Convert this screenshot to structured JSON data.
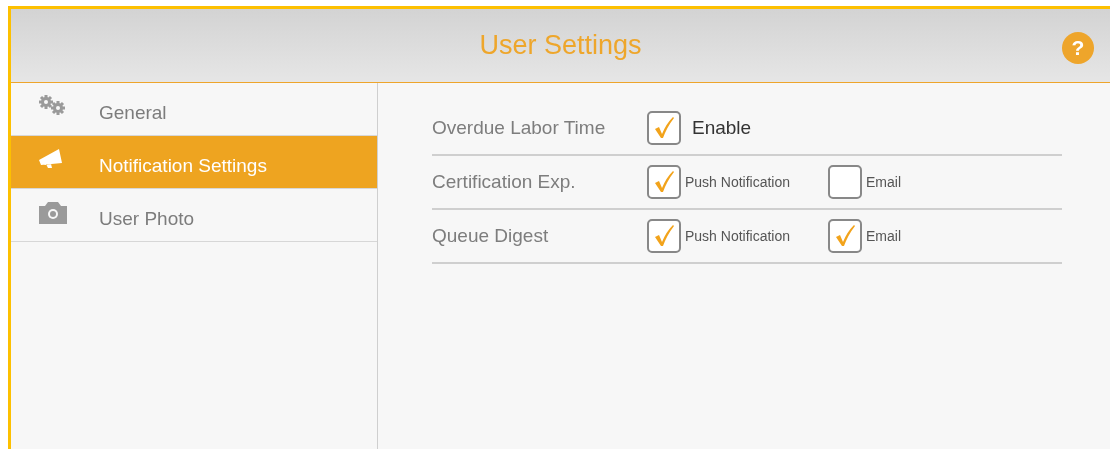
{
  "header": {
    "title": "User Settings",
    "help": "?"
  },
  "sidebar": {
    "items": [
      {
        "label": "General",
        "selected": false
      },
      {
        "label": "Notification Settings",
        "selected": true
      },
      {
        "label": "User Photo",
        "selected": false
      }
    ]
  },
  "settings": [
    {
      "label": "Overdue Labor Time",
      "kind": "single",
      "options": [
        {
          "label": "Enable",
          "checked": true
        }
      ]
    },
    {
      "label": "Certification Exp.",
      "kind": "pair",
      "options": [
        {
          "label": "Push Notification",
          "checked": true
        },
        {
          "label": "Email",
          "checked": false
        }
      ]
    },
    {
      "label": "Queue Digest",
      "kind": "pair",
      "options": [
        {
          "label": "Push Notification",
          "checked": true
        },
        {
          "label": "Email",
          "checked": true
        }
      ]
    }
  ]
}
